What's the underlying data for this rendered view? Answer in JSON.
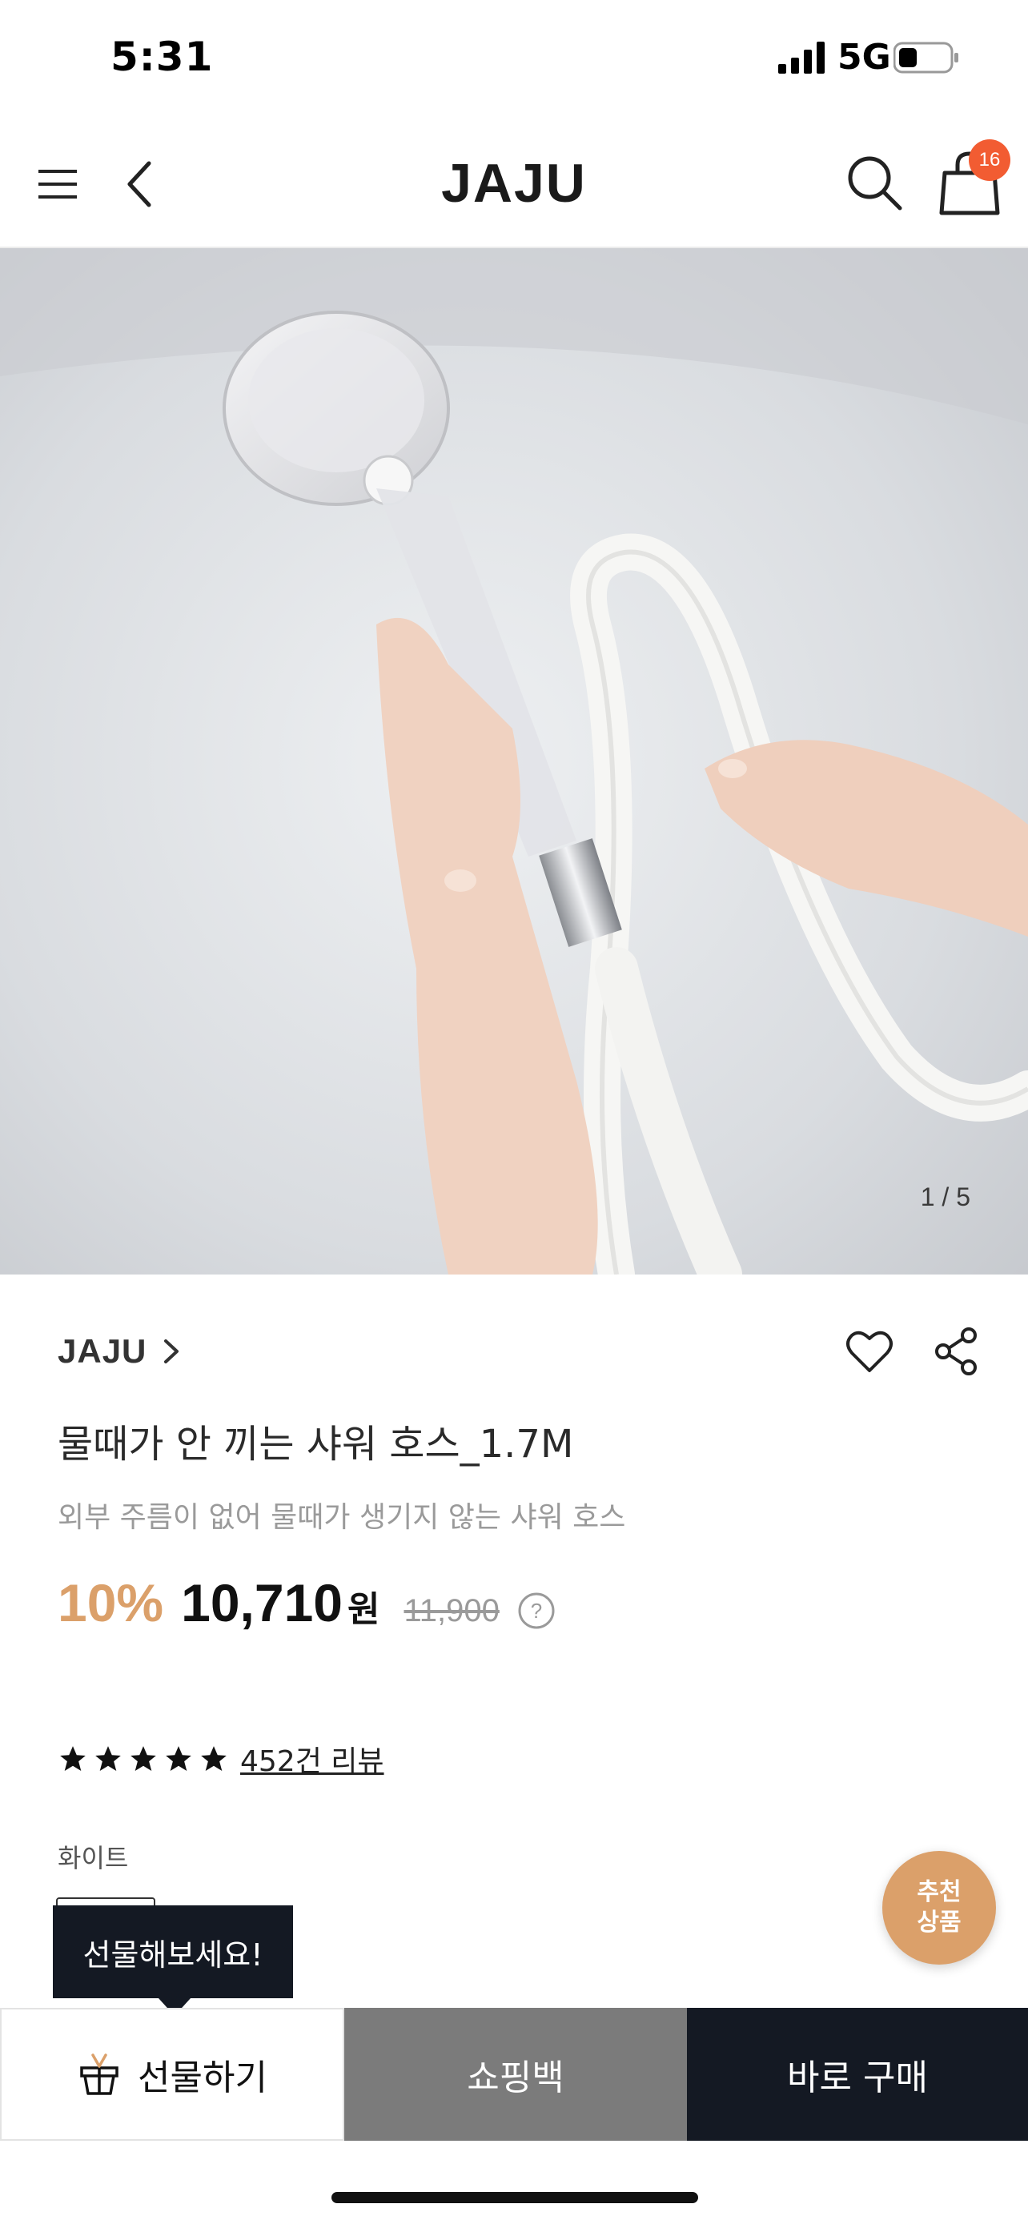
{
  "status_bar": {
    "time": "5:31",
    "network": "5G"
  },
  "nav": {
    "logo": "JAJU",
    "cart_count": "16",
    "icons": [
      "menu-icon",
      "back-icon",
      "search-icon",
      "cart-icon"
    ]
  },
  "hero": {
    "counter": "1 / 5"
  },
  "product": {
    "brand": "JAJU",
    "name": "물때가 안 끼는 샤워 호스_1.7M",
    "description": "외부 주름이 없어 물때가 생기지 않는 샤워 호스",
    "discount": "10%",
    "price": "10,710",
    "currency": "원",
    "original_price": "11,900",
    "rating": 5,
    "reviews": "452건 리뷰",
    "option_label": "화이트"
  },
  "fab": {
    "line1": "추천",
    "line2": "상품"
  },
  "tooltip": {
    "text": "선물해보세요!"
  },
  "bottom_bar": {
    "gift_label": "선물하기",
    "bag_label": "쇼핑백",
    "buy_label": "바로 구매"
  },
  "colors": {
    "accent": "#dba06a",
    "badge": "#f25c32",
    "dark": "#141923",
    "gray_button": "#7b7b7b"
  }
}
